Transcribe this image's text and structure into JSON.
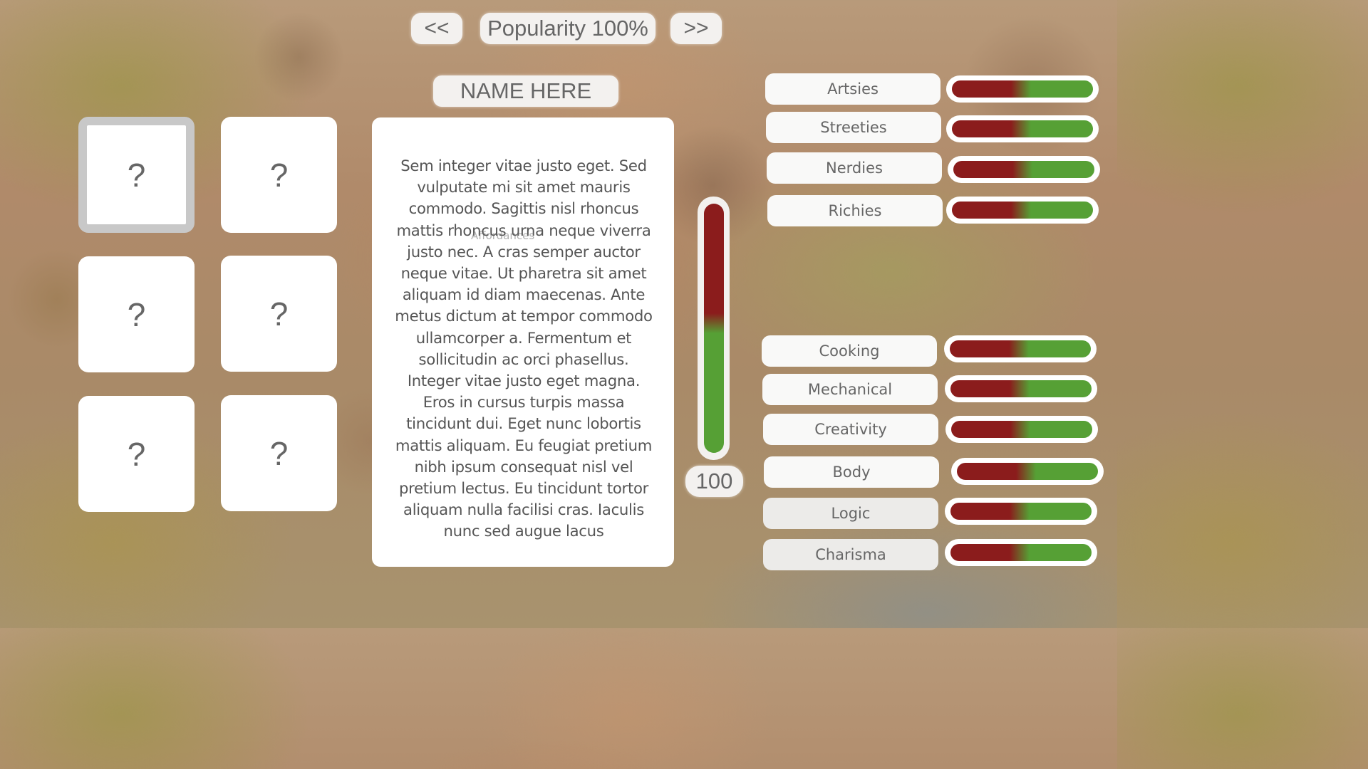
{
  "header": {
    "prev_label": "<<",
    "next_label": ">>",
    "popularity_label": "Popularity 100%"
  },
  "name_label": "NAME HERE",
  "cards": [
    "?",
    "?",
    "?",
    "?",
    "?",
    "?"
  ],
  "description": "Sem integer vitae justo eget. Sed vulputate mi sit amet mauris commodo. Sagittis nisl rhoncus mattis rhoncus urna neque viverra justo nec. A cras semper auctor neque vitae. Ut pharetra sit amet aliquam id diam maecenas. Ante metus dictum at tempor commodo ullamcorper a. Fermentum et sollicitudin ac orci phasellus. Integer vitae justo eget magna. Eros in cursus turpis massa tincidunt dui. Eget nunc lobortis mattis aliquam. Eu feugiat pretium nibh ipsum consequat nisl vel pretium lectus. Eu tincidunt tortor aliquam nulla facilisi cras. Iaculis nunc sed augue lacus",
  "ghost_label": "Affordances",
  "main_meter": {
    "value": "100",
    "fill_fraction": 1.0
  },
  "groups": [
    {
      "label": "Artsies",
      "fraction": 0.5
    },
    {
      "label": "Streeties",
      "fraction": 0.5
    },
    {
      "label": "Nerdies",
      "fraction": 0.5
    },
    {
      "label": "Richies",
      "fraction": 0.5
    }
  ],
  "skills": [
    {
      "label": "Cooking",
      "fraction": 0.5
    },
    {
      "label": "Mechanical",
      "fraction": 0.5
    },
    {
      "label": "Creativity",
      "fraction": 0.5
    },
    {
      "label": "Body",
      "fraction": 0.5
    },
    {
      "label": "Logic",
      "fraction": 0.5
    },
    {
      "label": "Charisma",
      "fraction": 0.5
    }
  ],
  "colors": {
    "bar_low": "#8b1c1c",
    "bar_high": "#56a035",
    "panel": "#ffffff",
    "pill": "#f3f1ef",
    "text": "#666666"
  }
}
